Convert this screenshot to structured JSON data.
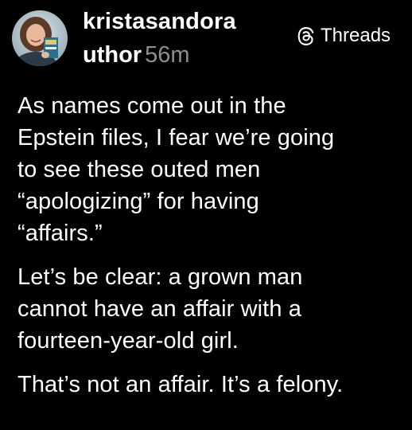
{
  "post": {
    "username": "kristasandora",
    "handle_fragment": "uthor",
    "timestamp": "56m",
    "brand_label": "Threads",
    "paragraphs": [
      [
        "As names come out in the",
        "Epstein files, I fear we’re going",
        "to see these outed men",
        "“apologizing” for having",
        "“affairs.”"
      ],
      [
        "Let’s be clear: a grown man",
        "cannot have an affair with a",
        "fourteen-year-old girl."
      ],
      [
        "That’s not an affair. It’s a felony."
      ]
    ]
  },
  "icons": {
    "avatar": "user-avatar-photo",
    "brand": "threads-logo-icon"
  },
  "colors": {
    "background": "#000000",
    "text": "#ffffff",
    "muted": "#8e8e93"
  }
}
